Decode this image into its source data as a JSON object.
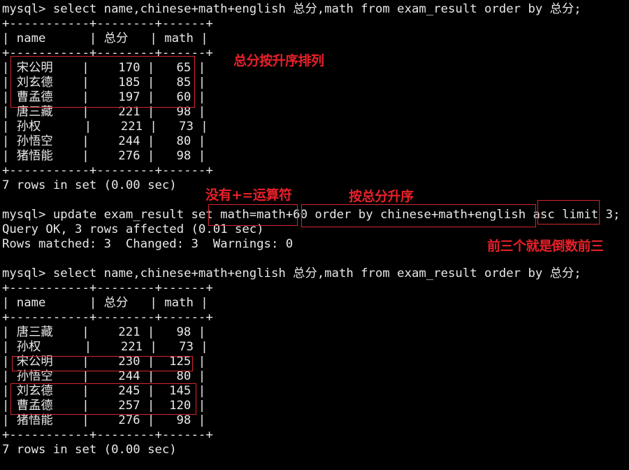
{
  "terminal": {
    "prompt": "mysql> ",
    "query1": "select name,chinese+math+english 总分,math from exam_result order by 总分;",
    "table_border": "+-----------+--------+------+",
    "table1": {
      "headers": [
        "name",
        "总分",
        "math"
      ],
      "rows": [
        [
          "宋公明",
          "170",
          "65"
        ],
        [
          "刘玄德",
          "185",
          "85"
        ],
        [
          "曹孟德",
          "197",
          "60"
        ],
        [
          "唐三藏",
          "221",
          "98"
        ],
        [
          "孙权",
          "221",
          "73"
        ],
        [
          "孙悟空",
          "244",
          "80"
        ],
        [
          "猪悟能",
          "276",
          "98"
        ]
      ],
      "footer": "7 rows in set (0.00 sec)"
    },
    "update_query": {
      "prefix": "update exam_result set ",
      "set_clause": "math=math+60",
      "order_clause": "order by chinese+math+english asc",
      "limit_clause": "limit 3;"
    },
    "update_result": [
      "Query OK, 3 rows affected (0.01 sec)",
      "Rows matched: 3  Changed: 3  Warnings: 0"
    ],
    "query2": "select name,chinese+math+english 总分,math from exam_result order by 总分;",
    "table2": {
      "headers": [
        "name",
        "总分",
        "math"
      ],
      "rows": [
        [
          "唐三藏",
          "221",
          "98"
        ],
        [
          "孙权",
          "221",
          "73"
        ],
        [
          "宋公明",
          "230",
          "125"
        ],
        [
          "孙悟空",
          "244",
          "80"
        ],
        [
          "刘玄德",
          "245",
          "145"
        ],
        [
          "曹孟德",
          "257",
          "120"
        ],
        [
          "猪悟能",
          "276",
          "98"
        ]
      ],
      "footer": "7 rows in set (0.00 sec)"
    }
  },
  "annotations": {
    "ascending_note": "总分按升序排列",
    "no_plus_equals_note": "没有+=运算符",
    "order_asc_note": "按总分升序",
    "limit_note": "前三个就是倒数前三",
    "color": "#e8202a"
  }
}
